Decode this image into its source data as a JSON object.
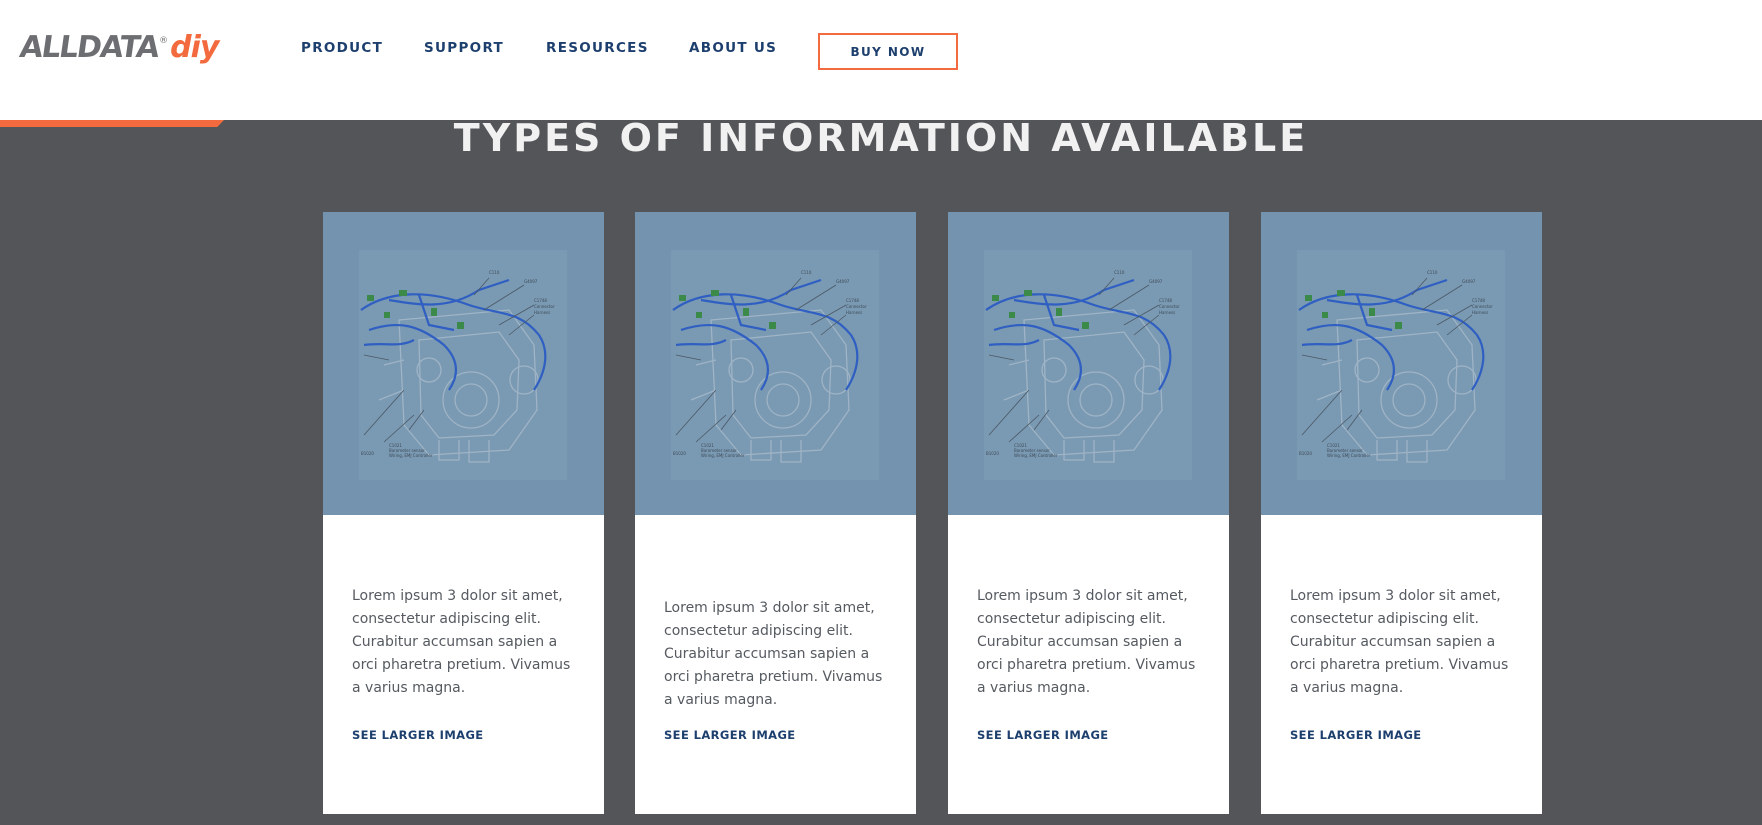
{
  "header": {
    "logo_main": "ALLDATA",
    "logo_reg": "®",
    "logo_diy": "diy",
    "nav": [
      {
        "label": "PRODUCT"
      },
      {
        "label": "SUPPORT"
      },
      {
        "label": "RESOURCES"
      },
      {
        "label": "ABOUT US"
      }
    ],
    "buy_label": "BUY NOW"
  },
  "section": {
    "title": "TYPES OF INFORMATION AVAILABLE"
  },
  "cards": [
    {
      "text": "Lorem ipsum 3 dolor sit amet, consectetur adipiscing elit. Curabitur accumsan sapien a orci pharetra pretium. Vivamus a varius magna.",
      "link": "SEE LARGER IMAGE"
    },
    {
      "text": "Lorem ipsum 3 dolor sit amet, consectetur adipiscing elit. Curabitur accumsan sapien a orci pharetra pretium. Vivamus a varius magna.",
      "link": "SEE LARGER IMAGE"
    },
    {
      "text": "Lorem ipsum 3 dolor sit amet, consectetur adipiscing elit. Curabitur accumsan sapien a orci pharetra pretium. Vivamus a varius magna.",
      "link": "SEE LARGER IMAGE"
    },
    {
      "text": "Lorem ipsum 3 dolor sit amet, consectetur adipiscing elit. Curabitur accumsan sapien a orci pharetra pretium. Vivamus a varius magna.",
      "link": "SEE LARGER IMAGE"
    }
  ],
  "colors": {
    "brand_orange": "#f26a3d",
    "navy": "#1d3f6e",
    "section_bg": "#545559",
    "image_tint": "#7393ae"
  },
  "icons": [
    "engine-diagram-image"
  ]
}
